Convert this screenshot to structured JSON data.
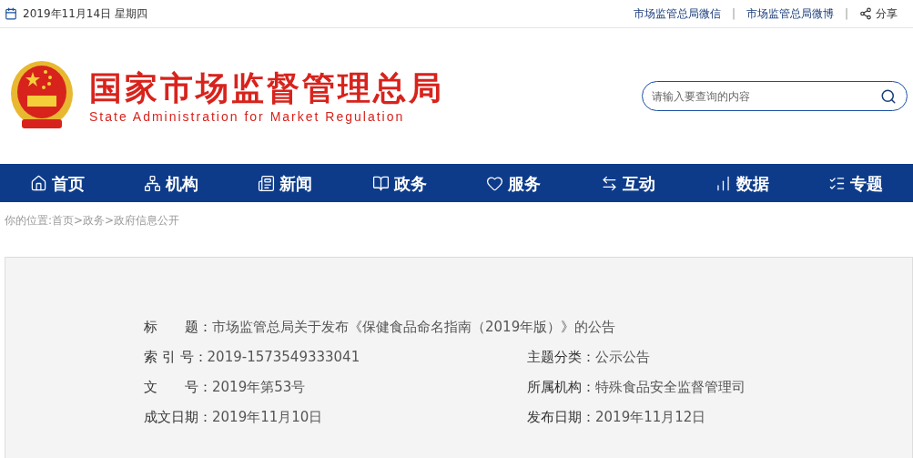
{
  "top_bar": {
    "date": "2019年11月14日 星期四",
    "links": [
      "市场监管总局微信",
      "市场监管总局微博"
    ],
    "separators": [
      "|",
      "|"
    ],
    "share": "分享"
  },
  "header": {
    "title": "国家市场监督管理总局",
    "subtitle": "State Administration for Market Regulation",
    "search": {
      "placeholder": "请输入要查询的内容"
    }
  },
  "nav": [
    {
      "label": "首页"
    },
    {
      "label": "机构"
    },
    {
      "label": "新闻"
    },
    {
      "label": "政务"
    },
    {
      "label": "服务"
    },
    {
      "label": "互动"
    },
    {
      "label": "数据"
    },
    {
      "label": "专题"
    }
  ],
  "breadcrumb": {
    "prefix": "你的位置:",
    "items": [
      "首页",
      "政务",
      "政府信息公开"
    ],
    "separator": ">"
  },
  "info": {
    "title_label": "标　　题：",
    "title_value": "市场监管总局关于发布《保健食品命名指南（2019年版）》的公告",
    "fields": [
      {
        "label": "索 引 号：",
        "value": "2019-1573549333041"
      },
      {
        "label": "主题分类：",
        "value": "公示公告"
      },
      {
        "label": "文　　号：",
        "value": "2019年第53号"
      },
      {
        "label": "所属机构：",
        "value": "特殊食品安全监督管理司"
      },
      {
        "label": "成文日期：",
        "value": "2019年11月10日"
      },
      {
        "label": "发布日期：",
        "value": "2019年11月12日"
      }
    ]
  }
}
